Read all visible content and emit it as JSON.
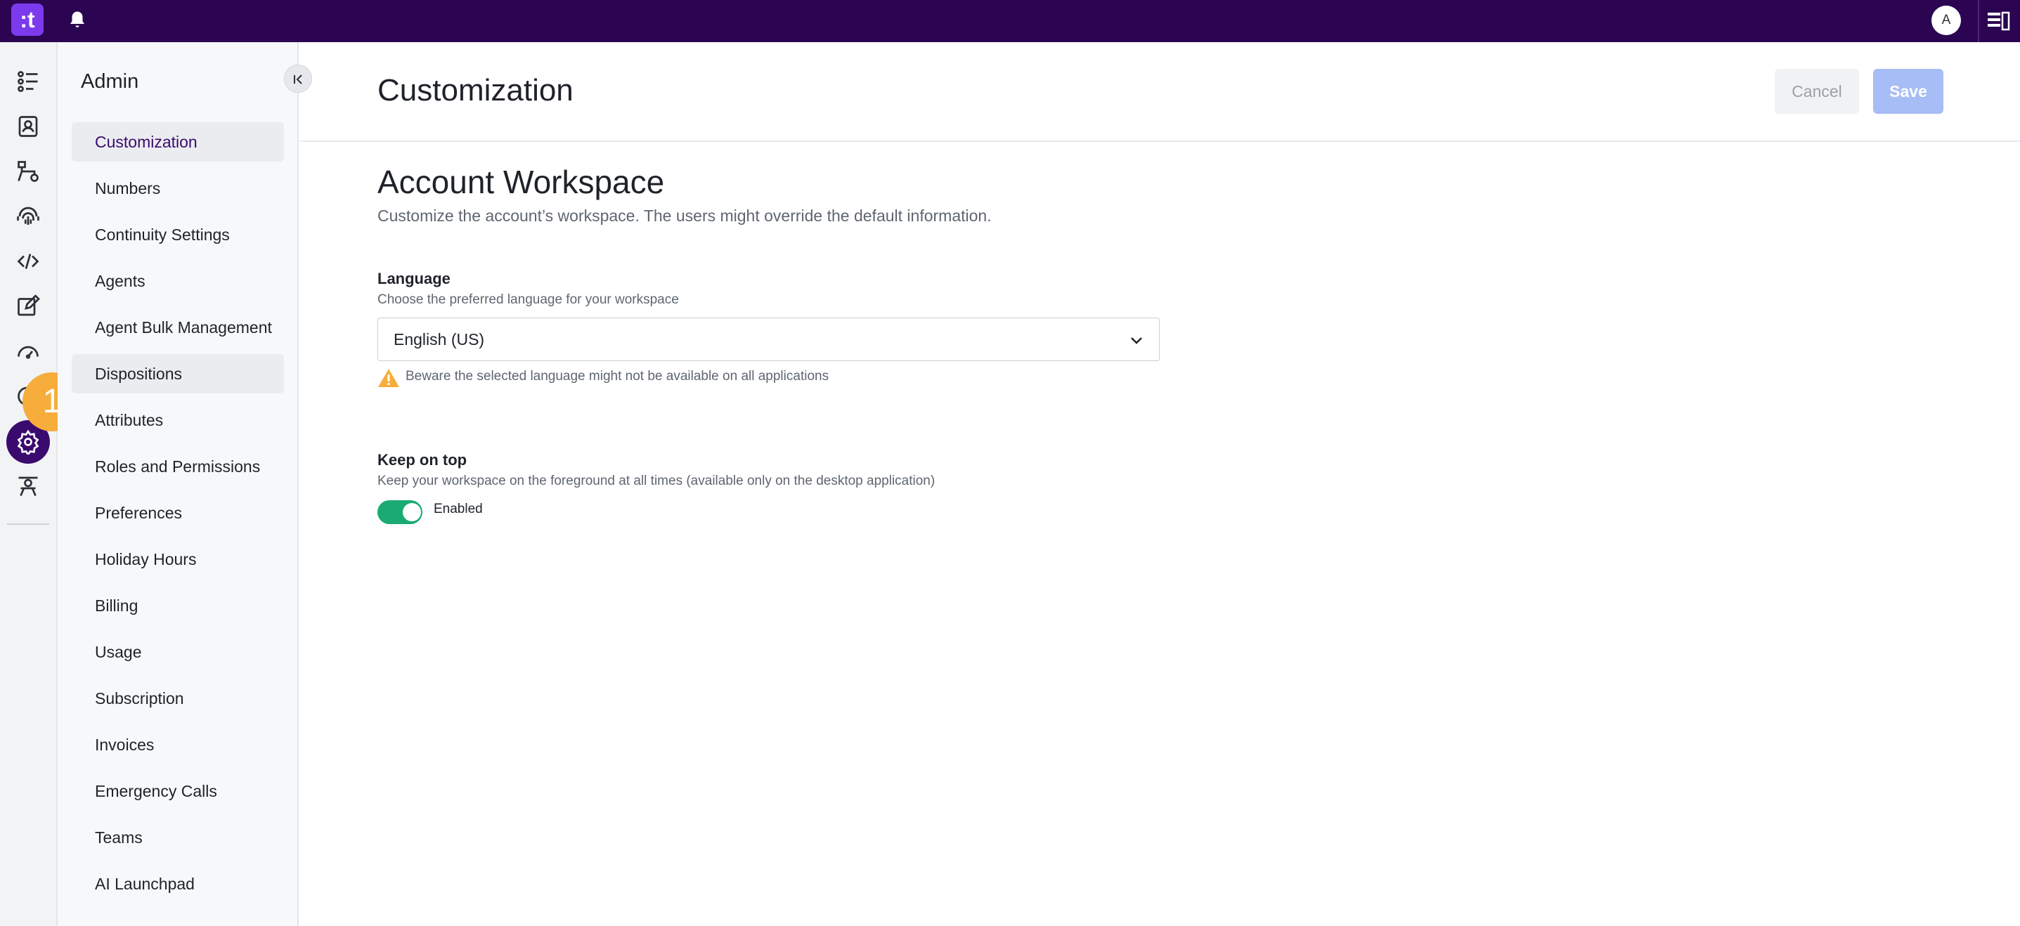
{
  "topbar": {
    "logo_text": ":t",
    "avatar_initial": "A",
    "bell_icon": "bell-icon",
    "panel_icon": "sidebar-panel-icon",
    "background": "#2b0552"
  },
  "rail": {
    "items": [
      {
        "icon": "list-icon"
      },
      {
        "icon": "contacts-book-icon"
      },
      {
        "icon": "flow-icon"
      },
      {
        "icon": "fingerprint-icon"
      },
      {
        "icon": "code-icon"
      },
      {
        "icon": "edit-icon"
      },
      {
        "icon": "speedometer-icon"
      },
      {
        "icon": "chat-icon"
      },
      {
        "icon": "gear-icon",
        "active": true
      },
      {
        "icon": "agent-desk-icon"
      }
    ],
    "badge": "1",
    "badge_color": "#f6ad3c",
    "active_color": "#3b0a6e"
  },
  "sidebar": {
    "title": "Admin",
    "items": [
      {
        "label": "Customization",
        "active": true
      },
      {
        "label": "Numbers"
      },
      {
        "label": "Continuity Settings"
      },
      {
        "label": "Agents"
      },
      {
        "label": "Agent Bulk Management"
      },
      {
        "label": "Dispositions",
        "hover": true
      },
      {
        "label": "Attributes"
      },
      {
        "label": "Roles and Permissions"
      },
      {
        "label": "Preferences"
      },
      {
        "label": "Holiday Hours"
      },
      {
        "label": "Billing"
      },
      {
        "label": "Usage"
      },
      {
        "label": "Subscription"
      },
      {
        "label": "Invoices"
      },
      {
        "label": "Emergency Calls"
      },
      {
        "label": "Teams"
      },
      {
        "label": "AI Launchpad"
      }
    ]
  },
  "main": {
    "title": "Customization",
    "cancel_label": "Cancel",
    "save_label": "Save",
    "section": {
      "title": "Account Workspace",
      "description": "Customize the account’s workspace. The users might override the default information."
    },
    "language": {
      "label": "Language",
      "help": "Choose the preferred language for your workspace",
      "value": "English (US)",
      "warning": "Beware the selected language might not be available on all applications"
    },
    "keep_on_top": {
      "label": "Keep on top",
      "help": "Keep your workspace on the foreground at all times (available only on the desktop application)",
      "state_label": "Enabled",
      "enabled": true,
      "toggle_color": "#1aaa74"
    }
  }
}
